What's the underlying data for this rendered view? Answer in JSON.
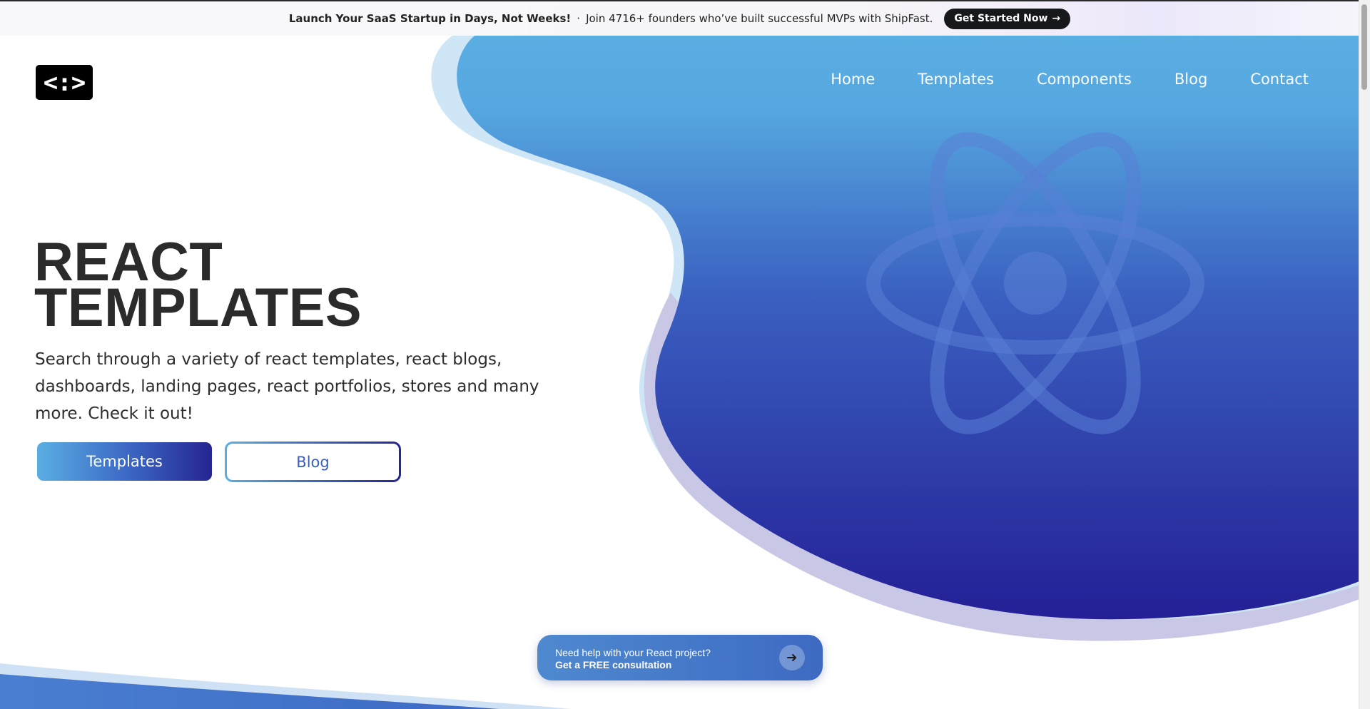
{
  "promo": {
    "headline": "Launch Your SaaS Startup in Days, Not Weeks!",
    "separator": "·",
    "text": "Join 4716+ founders who’ve built successful MVPs with ShipFast.",
    "cta_label": "Get Started Now",
    "cta_icon": "arrow-right-icon"
  },
  "logo": {
    "text": "<:>"
  },
  "nav": {
    "items": [
      {
        "label": "Home"
      },
      {
        "label": "Templates"
      },
      {
        "label": "Components"
      },
      {
        "label": "Blog"
      },
      {
        "label": "Contact"
      }
    ]
  },
  "hero": {
    "title_line1": "REACT",
    "title_line2": "TEMPLATES",
    "description": "Search through a variety of react templates, react blogs, dashboards, landing pages, react portfolios, stores and many more. Check it out!",
    "primary_button": "Templates",
    "secondary_button": "Blog",
    "background_icon": "react-atom-icon"
  },
  "consult": {
    "line1": "Need help with your React project?",
    "line2": "Get a FREE consultation",
    "icon": "arrow-right-icon"
  },
  "colors": {
    "blob_top": "#5aaee2",
    "blob_mid": "#3a5fc0",
    "blob_bottom": "#241f96",
    "promo_cta_bg": "#17181c",
    "text_dark": "#2b2b2b"
  }
}
